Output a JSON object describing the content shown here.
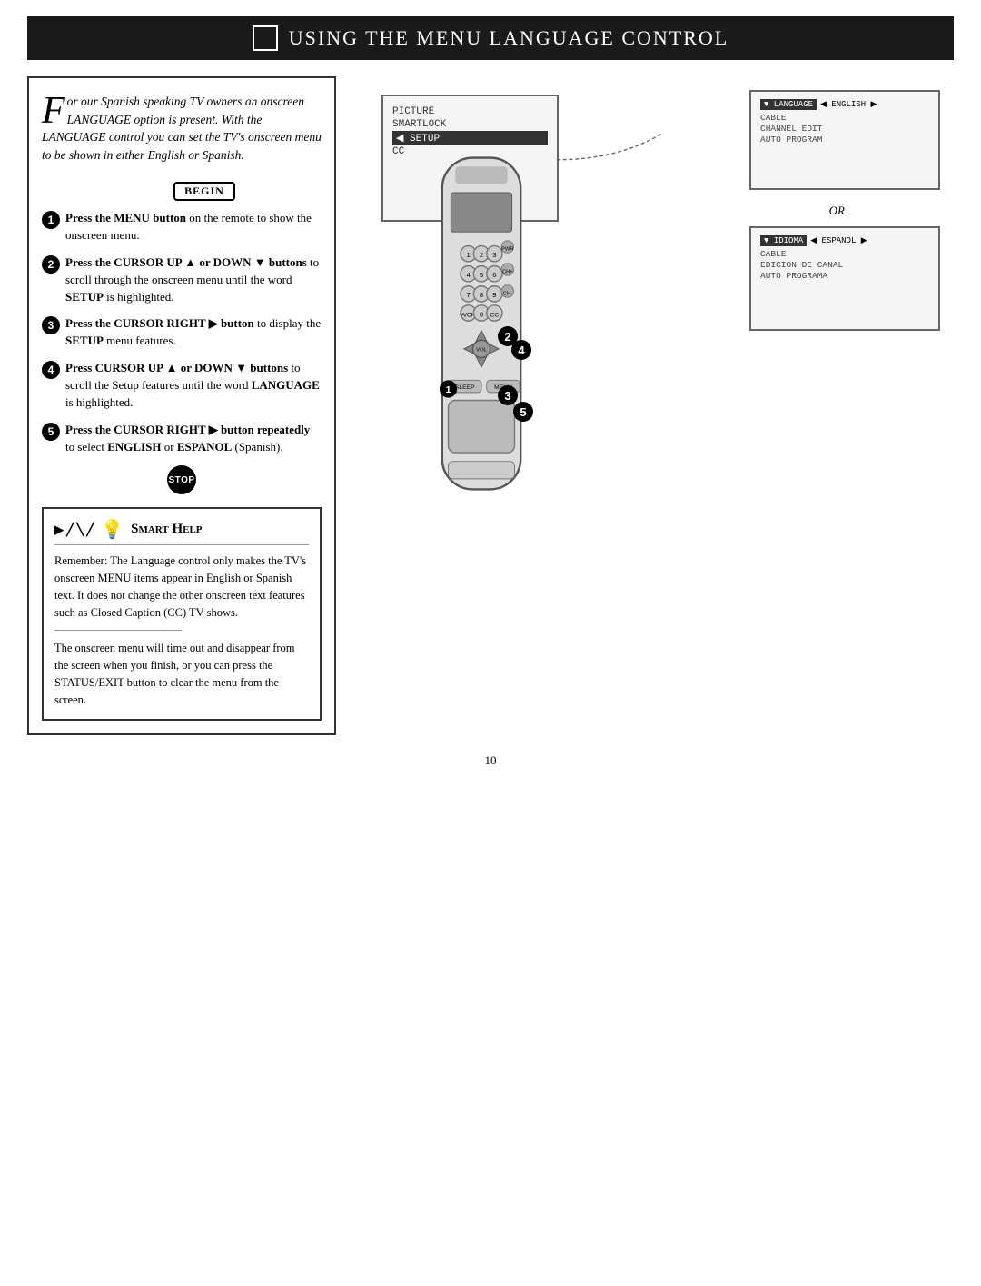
{
  "header": {
    "title": "Using the Menu Language Control",
    "icon_label": "tv-icon"
  },
  "intro": {
    "dropcap": "F",
    "text": "or our Spanish speaking TV owners an onscreen LANGUAGE option is present. With the LANGUAGE control you can set the TV's onscreen menu to be shown in either English or Spanish."
  },
  "begin_badge": "Begin",
  "steps": [
    {
      "num": "1",
      "text_parts": [
        {
          "bold": true,
          "text": "Press the MENU button"
        },
        {
          "bold": false,
          "text": " on the remote to show the onscreen menu."
        }
      ]
    },
    {
      "num": "2",
      "text_parts": [
        {
          "bold": true,
          "text": "Press the CURSOR UP ▲ or DOWN ▼ buttons"
        },
        {
          "bold": false,
          "text": " to scroll through the onscreen menu until the word "
        },
        {
          "bold": true,
          "text": "SETUP"
        },
        {
          "bold": false,
          "text": " is highlighted."
        }
      ]
    },
    {
      "num": "3",
      "text_parts": [
        {
          "bold": true,
          "text": "Press the CURSOR RIGHT ▶ button"
        },
        {
          "bold": false,
          "text": " to display the "
        },
        {
          "bold": true,
          "text": "SETUP"
        },
        {
          "bold": false,
          "text": " menu features."
        }
      ]
    },
    {
      "num": "4",
      "text_parts": [
        {
          "bold": true,
          "text": "Press CURSOR UP ▲ or DOWN ▼ buttons"
        },
        {
          "bold": false,
          "text": " to scroll the Setup features until the word "
        },
        {
          "bold": true,
          "text": "LANGUAGE"
        },
        {
          "bold": false,
          "text": " is highlighted."
        }
      ]
    },
    {
      "num": "5",
      "text_parts": [
        {
          "bold": true,
          "text": "Press the CURSOR RIGHT ▶ button repeatedly"
        },
        {
          "bold": false,
          "text": " to select "
        },
        {
          "bold": true,
          "text": "ENGLISH"
        },
        {
          "bold": false,
          "text": " or "
        },
        {
          "bold": true,
          "text": "ESPANOL"
        },
        {
          "bold": false,
          "text": " (Spanish)."
        }
      ]
    }
  ],
  "stop_label": "STOP",
  "smart_help": {
    "title": "Smart Help",
    "body": "Remember: The Language control only makes the TV's onscreen MENU items appear in English or Spanish text. It does not change the other onscreen text features such as Closed Caption (CC) TV shows.",
    "extra": "The onscreen menu will time out and disappear from the screen when you finish, or you can press the STATUS/EXIT button to clear the menu from the screen."
  },
  "screen_main": {
    "items": [
      "PICTURE",
      "SMARTLOCK",
      "SETUP",
      "CC"
    ],
    "selected": "SETUP",
    "has_arrow": true
  },
  "screen_english": {
    "lang_label": "◄ LANGUAGE",
    "lang_value": "◄ ENGLISH ▶",
    "items": [
      "CABLE",
      "CHANNEL EDIT",
      "AUTO PROGRAM"
    ]
  },
  "or_label": "OR",
  "screen_espanol": {
    "lang_label": "◄ IDIOMA",
    "lang_value": "◄ ESPANOL ▶",
    "items": [
      "CABLE",
      "EDICION DE CANAL",
      "AUTO PROGRAMA"
    ]
  },
  "page_number": "10"
}
